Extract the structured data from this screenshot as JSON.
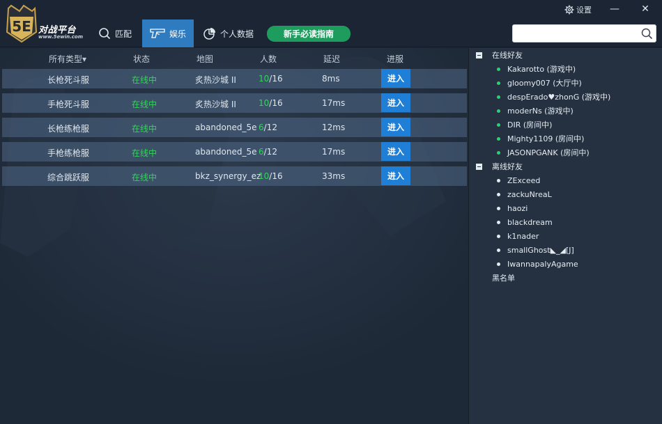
{
  "logo": {
    "badge": "5E",
    "title": "对战平台",
    "subtitle": "www.5ewin.com"
  },
  "nav": {
    "match": "匹配",
    "entertainment": "娱乐",
    "stats": "个人数据",
    "guide": "新手必读指南"
  },
  "window": {
    "settings": "设置",
    "minimize": "—",
    "close": "✕"
  },
  "search": {
    "value": "",
    "placeholder": ""
  },
  "columns": {
    "type": "所有类型▾",
    "status": "状态",
    "map": "地图",
    "players": "人数",
    "ping": "延迟",
    "join": "进服"
  },
  "servers": [
    {
      "type": "长枪死斗服",
      "status": "在线中",
      "map": "炙热沙城 II",
      "current": "10",
      "max": "/16",
      "ping": "8ms",
      "action": "进入"
    },
    {
      "type": "手枪死斗服",
      "status": "在线中",
      "map": "炙热沙城 II",
      "current": "10",
      "max": "/16",
      "ping": "17ms",
      "action": "进入"
    },
    {
      "type": "长枪练枪服",
      "status": "在线中",
      "map": "abandoned_5e",
      "current": "6",
      "max": "/12",
      "ping": "12ms",
      "action": "进入"
    },
    {
      "type": "手枪练枪服",
      "status": "在线中",
      "map": "abandoned_5e",
      "current": "6",
      "max": "/12",
      "ping": "17ms",
      "action": "进入"
    },
    {
      "type": "综合跳跃服",
      "status": "在线中",
      "map": "bkz_synergy_ez",
      "current": "10",
      "max": "/16",
      "ping": "33ms",
      "action": "进入"
    }
  ],
  "friends": {
    "online_label": "在线好友",
    "online": [
      "Kakarotto (游戏中)",
      "gloomy007 (大厅中)",
      "despErado♥zhonG (游戏中)",
      "moderNs (游戏中)",
      "DIR (房间中)",
      "Mighty1109 (房间中)",
      "JASONPGANK (房间中)"
    ],
    "offline_label": "离线好友",
    "offline": [
      "ZExceed",
      "zackuNreaL",
      "haozi",
      "blackdream",
      "k1nader",
      "smallGhost◣_◢[J]",
      "IwannapalyAgame"
    ],
    "blacklist_label": "黑名单"
  },
  "colors": {
    "accent": "#2e7bbf",
    "join_button": "#1f7fd6",
    "online_green": "#36d35c",
    "guide_green": "#1e9c5e"
  }
}
